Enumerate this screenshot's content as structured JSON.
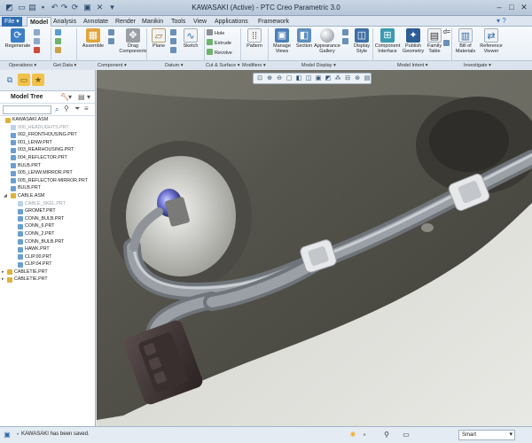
{
  "app": {
    "title": "KAWASAKI (Active) - PTC Creo Parametric 3.0"
  },
  "tabs": [
    {
      "label": "File ▾"
    },
    {
      "label": "Model"
    },
    {
      "label": "Analysis"
    },
    {
      "label": "Annotate"
    },
    {
      "label": "Render"
    },
    {
      "label": "Manikin"
    },
    {
      "label": "Tools"
    },
    {
      "label": "View"
    },
    {
      "label": "Applications"
    },
    {
      "label": "Framework"
    }
  ],
  "ribbon": {
    "regenerate": "Regenerate",
    "assemble": "Assemble",
    "drag_components": "Drag Components",
    "plane": "Plane",
    "sketch": "Sketch",
    "hole": "Hole",
    "extrude": "Extrude",
    "revolve": "Revolve",
    "pattern": "Pattern",
    "manage_views": "Manage Views",
    "section": "Section",
    "appearance_gallery": "Appearance Gallery",
    "display_style": "Display Style",
    "component_interface": "Component Interface",
    "publish_geometry": "Publish Geometry",
    "family_table": "Family Table",
    "bill_of_materials": "Bill of Materials",
    "reference_viewer": "Reference Viewer"
  },
  "groups": [
    {
      "label": "Operations ▾"
    },
    {
      "label": "Get Data ▾"
    },
    {
      "label": "Component ▾"
    },
    {
      "label": "Datum ▾"
    },
    {
      "label": "Cut & Surface ▾"
    },
    {
      "label": "Modifiers ▾"
    },
    {
      "label": "Model Display ▾"
    },
    {
      "label": "Model Intent ▾"
    },
    {
      "label": "Investigate ▾"
    }
  ],
  "model_tree": {
    "title": "Model Tree",
    "items": [
      {
        "label": "KAWASAKI.ASM"
      },
      {
        "label": "000_HEADLIGHTS.PRT"
      },
      {
        "label": "002_FRONTHOUSING.PRT"
      },
      {
        "label": "001_LENW.PRT"
      },
      {
        "label": "003_REARHOUSING.PRT"
      },
      {
        "label": "004_REFLECTOR.PRT"
      },
      {
        "label": "BULB.PRT"
      },
      {
        "label": "005_LENW.MIRROR.PRT"
      },
      {
        "label": "005_REFLECTOR-MIRROR.PRT"
      },
      {
        "label": "BULB.PRT"
      },
      {
        "label": "CABLE.ASM"
      },
      {
        "label": "CABLE_SKEL.PRT"
      },
      {
        "label": "GROMET.PRT"
      },
      {
        "label": "CONN_BULB.PRT"
      },
      {
        "label": "CONN_6.PRT"
      },
      {
        "label": "CONN_2.PRT"
      },
      {
        "label": "CONN_BULB.PRT"
      },
      {
        "label": "HAWK.PRT"
      },
      {
        "label": "CLIP.00.PRT"
      },
      {
        "label": "CLIP.04.PRT"
      },
      {
        "label": "CABLETIE.PRT"
      },
      {
        "label": "CABLETIE.PRT"
      }
    ]
  },
  "status": {
    "message": "KAWASAKI has been saved.",
    "filter": "Smart"
  }
}
